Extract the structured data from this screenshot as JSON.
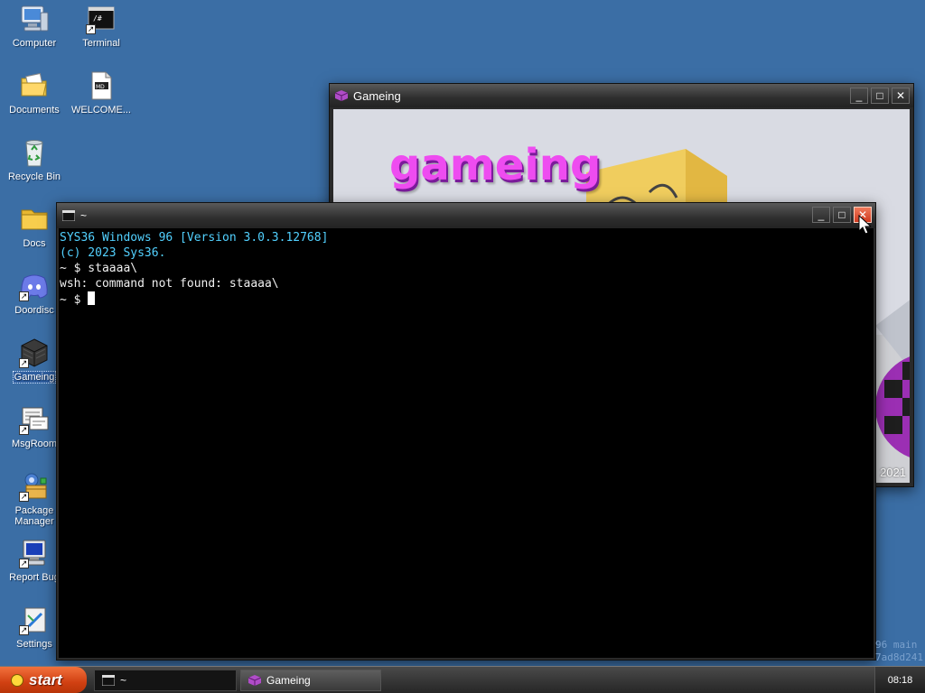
{
  "desktop": {
    "icons": [
      {
        "label": "Computer"
      },
      {
        "label": "Terminal"
      },
      {
        "label": "Documents"
      },
      {
        "label": "WELCOME..."
      },
      {
        "label": "Recycle Bin"
      },
      {
        "label": "Docs"
      },
      {
        "label": "Doordisc"
      },
      {
        "label": "Gameing"
      },
      {
        "label": "MsgRoom"
      },
      {
        "label": "Package Manager"
      },
      {
        "label": "Report Bug"
      },
      {
        "label": "Settings"
      }
    ],
    "terminal_icon_glyph": "/#",
    "welcome_icon_glyph": "MD",
    "watermark_line1": "96 main",
    "watermark_line2": "7ad8d241"
  },
  "gameing_window": {
    "title": "Gameing",
    "game_title": "gameing",
    "year": "2021",
    "minimize": "_",
    "maximize": "□",
    "close": "✕"
  },
  "terminal_window": {
    "title": "~",
    "icon_glyph": "/#",
    "minimize": "_",
    "maximize": "□",
    "close": "✕",
    "lines": [
      "SYS36 Windows 96 [Version 3.0.3.12768]",
      "(c) 2023 Sys36.",
      "",
      "~ $ staaaa\\",
      "wsh: command not found: staaaa\\",
      "~ $ "
    ]
  },
  "taskbar": {
    "start_label": "start",
    "tasks": [
      {
        "label": "~"
      },
      {
        "label": "Gameing"
      }
    ],
    "clock": "08:18"
  },
  "colors": {
    "desktop_bg": "#3b6ea5",
    "terminal_text_cyan": "#52d1ff",
    "game_title_pink": "#ee4cf0",
    "start_orange": "#d14012",
    "close_red": "#d0391e"
  }
}
